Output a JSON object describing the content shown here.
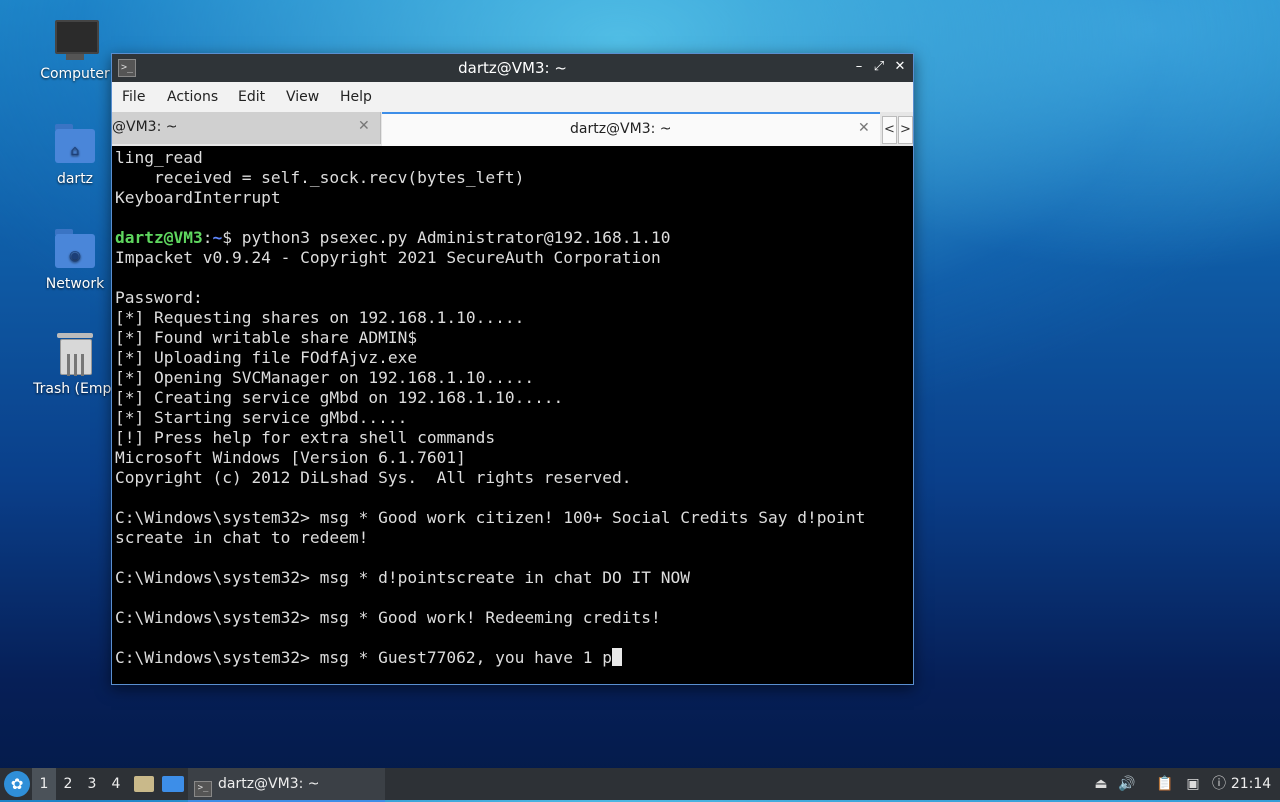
{
  "desktop": {
    "icons": [
      {
        "label": "Computer"
      },
      {
        "label": "dartz"
      },
      {
        "label": "Network"
      },
      {
        "label": "Trash (Empt"
      }
    ]
  },
  "window": {
    "title": "dartz@VM3: ~",
    "buttons": {
      "minimize": "–",
      "maximize": "⤢",
      "close": "✕"
    },
    "menu": [
      "File",
      "Actions",
      "Edit",
      "View",
      "Help"
    ],
    "tabs": [
      {
        "label": "@VM3: ~",
        "close": "✕"
      },
      {
        "label": "dartz@VM3: ~",
        "close": "✕"
      }
    ],
    "tab_nav": {
      "prev": "<",
      "next": ">"
    }
  },
  "terminal": {
    "lines": [
      "ling_read",
      "    received = self._sock.recv(bytes_left)",
      "KeyboardInterrupt",
      "",
      "PROMPT",
      "Impacket v0.9.24 - Copyright 2021 SecureAuth Corporation",
      "",
      "Password:",
      "[*] Requesting shares on 192.168.1.10.....",
      "[*] Found writable share ADMIN$",
      "[*] Uploading file FOdfAjvz.exe",
      "[*] Opening SVCManager on 192.168.1.10.....",
      "[*] Creating service gMbd on 192.168.1.10.....",
      "[*] Starting service gMbd.....",
      "[!] Press help for extra shell commands",
      "Microsoft Windows [Version 6.1.7601]",
      "Copyright (c) 2012 DiLshad Sys.  All rights reserved.",
      "",
      "C:\\Windows\\system32> msg * Good work citizen! 100+ Social Credits Say d!point",
      "screate in chat to redeem!",
      "",
      "C:\\Windows\\system32> msg * d!pointscreate in chat DO IT NOW",
      "",
      "C:\\Windows\\system32> msg * Good work! Redeeming credits!",
      "",
      "CURSORLINE"
    ],
    "prompt": {
      "user": "dartz@VM3",
      "sep": ":",
      "path": "~",
      "symbol": "$ ",
      "command": "python3 psexec.py Administrator@192.168.1.10"
    },
    "current_input": "C:\\Windows\\system32> msg * Guest77062, you have 1 p"
  },
  "taskbar": {
    "start_icon": "start-menu-icon",
    "workspaces": [
      "1",
      "2",
      "3",
      "4"
    ],
    "active_workspace": "1",
    "task": {
      "label": "dartz@VM3: ~"
    },
    "clock": "21:14"
  },
  "colors": {
    "prompt_user": "#5fd75f",
    "prompt_path": "#5f87ff",
    "active_tab_accent": "#3d8ee8"
  }
}
